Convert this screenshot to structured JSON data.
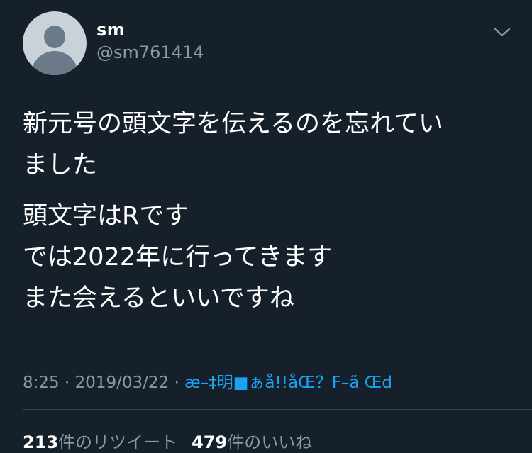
{
  "colors": {
    "background": "#15202b",
    "text": "#ffffff",
    "secondary_text": "#8899a6",
    "link": "#1da1f2",
    "divider": "#38444d"
  },
  "user": {
    "display_name": "sm",
    "handle": "@sm761414",
    "avatar_icon": "default-profile-icon"
  },
  "header": {
    "menu_icon": "chevron-down-icon"
  },
  "tweet": {
    "lines": [
      "新元号の頭文字を伝えるのを忘れてい",
      "ました",
      "頭文字はRです",
      "では2022年に行ってきます",
      "また会えるといいですね"
    ]
  },
  "meta": {
    "time": "8:25",
    "separator1": " · ",
    "date": "2019/03/22",
    "separator2": " · ",
    "source": "æ–‡明■ぁå!!åŒ？F–ã Œd"
  },
  "stats": {
    "retweets_count": "213",
    "retweets_label": "件のリツイート",
    "likes_count": "479",
    "likes_label": "件のいいね"
  }
}
